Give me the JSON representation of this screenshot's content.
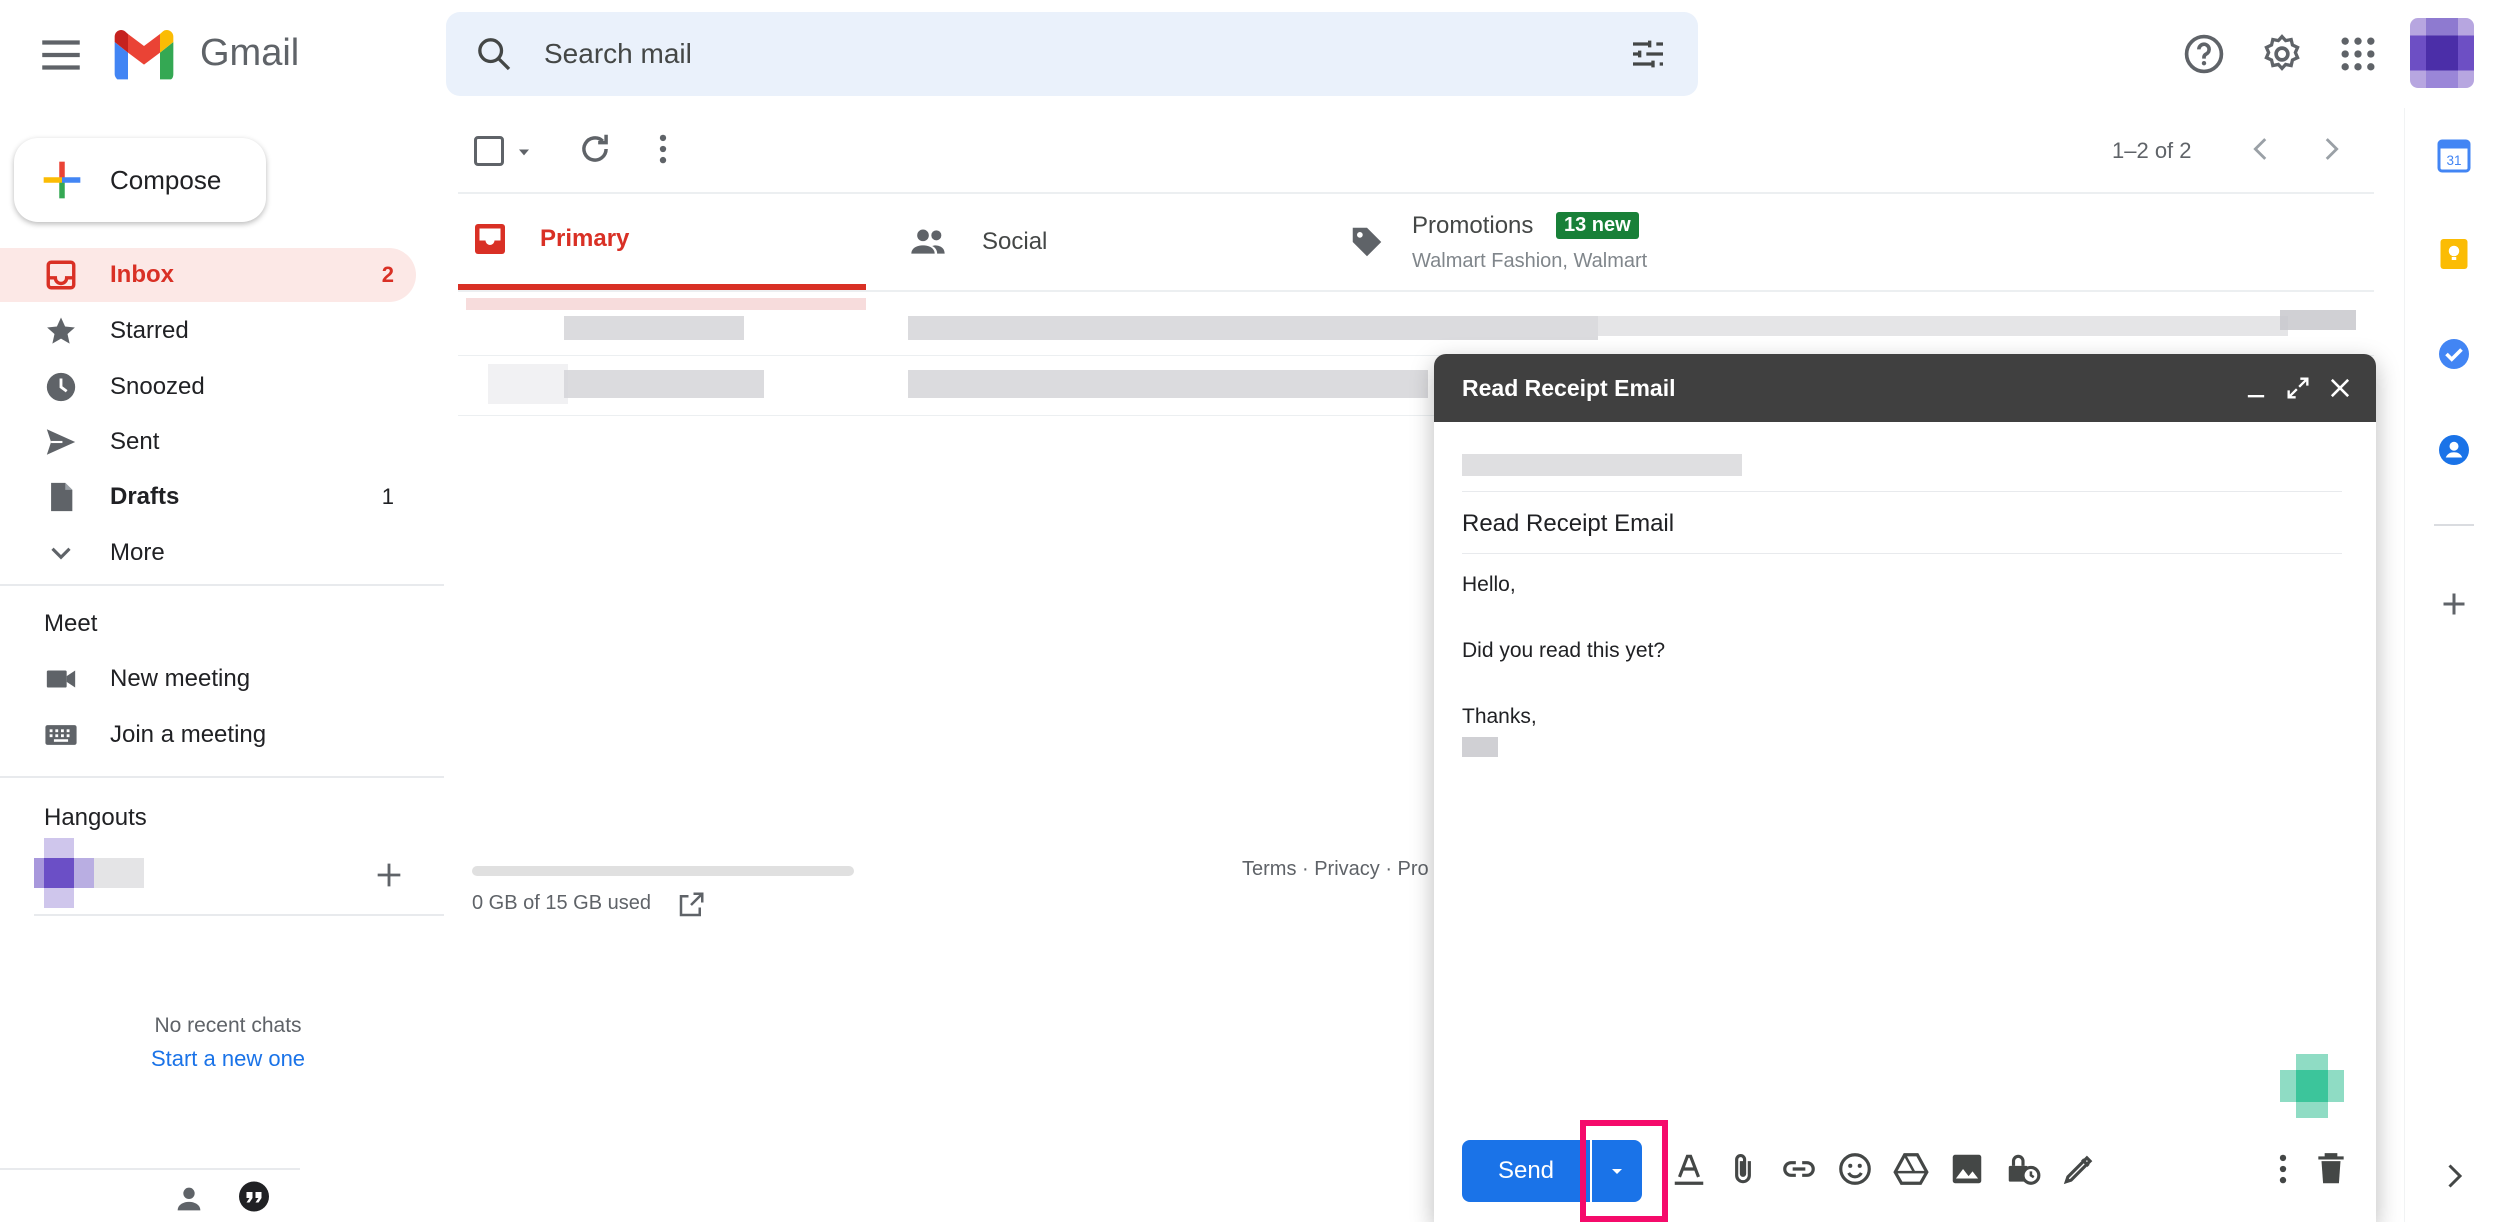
{
  "header": {
    "app_name": "Gmail",
    "search_placeholder": "Search mail"
  },
  "sidebar": {
    "compose_label": "Compose",
    "items": [
      {
        "label": "Inbox",
        "count": "2"
      },
      {
        "label": "Starred",
        "count": ""
      },
      {
        "label": "Snoozed",
        "count": ""
      },
      {
        "label": "Sent",
        "count": ""
      },
      {
        "label": "Drafts",
        "count": "1"
      },
      {
        "label": "More",
        "count": ""
      }
    ],
    "meet": {
      "title": "Meet",
      "new_meeting": "New meeting",
      "join_meeting": "Join a meeting"
    },
    "hangouts": {
      "title": "Hangouts",
      "no_chats": "No recent chats",
      "start_new": "Start a new one"
    }
  },
  "toolbar": {
    "pagination": "1–2 of 2"
  },
  "tabs": {
    "primary": "Primary",
    "social": "Social",
    "promotions": "Promotions",
    "promotions_badge": "13 new",
    "promotions_senders": "Walmart Fashion, Walmart"
  },
  "footer": {
    "storage": "0 GB of 15 GB used",
    "links": "Terms · Privacy · Pro"
  },
  "compose_window": {
    "title": "Read Receipt Email",
    "subject": "Read Receipt Email",
    "body_lines": [
      "Hello,",
      "",
      "Did you read this yet?",
      "",
      "Thanks,"
    ],
    "send_label": "Send"
  },
  "colors": {
    "accent_red": "#d93025",
    "send_blue": "#1a73e8",
    "highlight_pink": "#f50b6b",
    "promo_badge_green": "#188038",
    "compose_header": "#404040"
  }
}
